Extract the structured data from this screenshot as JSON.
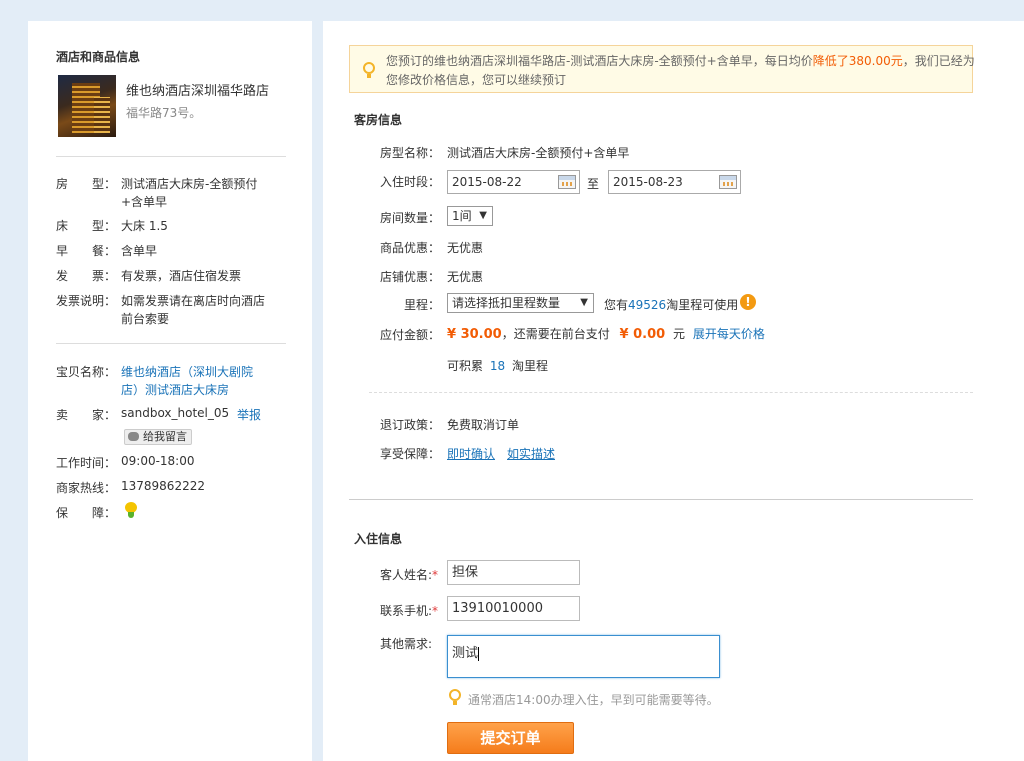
{
  "left": {
    "section_title": "酒店和商品信息",
    "hotel_name": "维也纳酒店深圳福华路店",
    "hotel_address": "福华路73号。",
    "rows": [
      {
        "label": "房　　型：",
        "value": "测试酒店大床房-全额预付\n+含单早"
      },
      {
        "label": "床　　型：",
        "value": "大床 1.5"
      },
      {
        "label": "早　　餐：",
        "value": "含单早"
      },
      {
        "label": "发　　票：",
        "value": "有发票，酒店住宿发票"
      },
      {
        "label": "发票说明：",
        "value": "如需发票请在离店时向酒店\n前台索要"
      }
    ],
    "item_name_label": "宝贝名称：",
    "item_name_value": "维也纳酒店（深圳大剧院\n店）测试酒店大床房",
    "seller_label": "卖　　家：",
    "seller_value": "sandbox_hotel_05",
    "report_link": "举报",
    "message_button": "给我留言",
    "hours_label": "工作时间：",
    "hours_value": "09:00-18:00",
    "hotline_label": "商家热线：",
    "hotline_value": "13789862222",
    "guarantee_label": "保　　障：",
    "guarantee_icon": "guarantee-icon"
  },
  "notice": {
    "text_before": "您预订的维也纳酒店深圳福华路店-测试酒店大床房-全额预付+含单早，每日均价",
    "text_highlight": "降低了380.00元",
    "text_after": "，我们已经为",
    "line2": "您修改价格信息，您可以继续预订",
    "icon": "lightbulb-icon"
  },
  "room": {
    "section_title": "客房信息",
    "room_type_label": "房型名称：",
    "room_type_value": "测试酒店大床房-全额预付+含单早",
    "checkin_label": "入住时段：",
    "checkin_date": "2015-08-22",
    "to_label": "至",
    "checkout_date": "2015-08-23",
    "rooms_label": "房间数量：",
    "rooms_value": "1间",
    "product_discount_label": "商品优惠：",
    "product_discount_value": "无优惠",
    "shop_discount_label": "店铺优惠：",
    "shop_discount_value": "无优惠",
    "mileage_label": "里程：",
    "mileage_select": "请选择抵扣里程数量",
    "mileage_have_prefix": "您有",
    "mileage_have_amount": "49526",
    "mileage_have_suffix": "淘里程可使用",
    "payable_label": "应付金额：",
    "payable_amount": "¥ 30.00",
    "payable_mid": "，还需要在前台支付",
    "frontdesk_amount": "¥ 0.00",
    "frontdesk_unit": "元",
    "expand_link": "展开每天价格",
    "accumulate_prefix": "可积累",
    "accumulate_amount": "18",
    "accumulate_suffix": "淘里程",
    "cancel_label": "退订政策：",
    "cancel_value": "免费取消订单",
    "protect_label": "享受保障：",
    "protect_link1": "即时确认",
    "protect_link2": "如实描述"
  },
  "guest": {
    "section_title": "入住信息",
    "name_label": "客人姓名:",
    "name_value": "担保",
    "phone_label": "联系手机:",
    "phone_value": "13910010000",
    "other_label": "其他需求:",
    "other_value": "测试",
    "tip": "通常酒店14:00办理入住，早到可能需要等待。",
    "submit": "提交订单"
  }
}
